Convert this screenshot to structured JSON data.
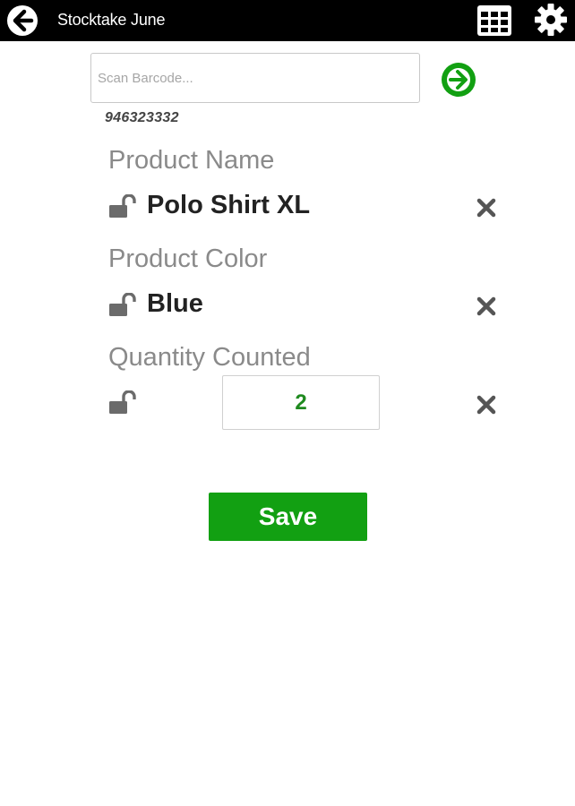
{
  "header": {
    "title": "Stocktake June",
    "back_icon": "arrow-left-circle-icon",
    "grid_icon": "table-grid-icon",
    "settings_icon": "gear-icon"
  },
  "scan": {
    "placeholder": "Scan Barcode...",
    "value": "",
    "go_icon": "arrow-right-circle-icon",
    "last_barcode": "946323332"
  },
  "fields": {
    "product_name": {
      "label": "Product Name",
      "value": "Polo Shirt XL"
    },
    "product_color": {
      "label": "Product Color",
      "value": "Blue"
    },
    "quantity": {
      "label": "Quantity Counted",
      "value": "2"
    }
  },
  "actions": {
    "save_label": "Save"
  },
  "colors": {
    "header_bg": "#000000",
    "accent_green": "#12a012",
    "quantity_text": "#1f8a1f",
    "label_gray": "#8a8a8a",
    "icon_gray": "#666666"
  }
}
